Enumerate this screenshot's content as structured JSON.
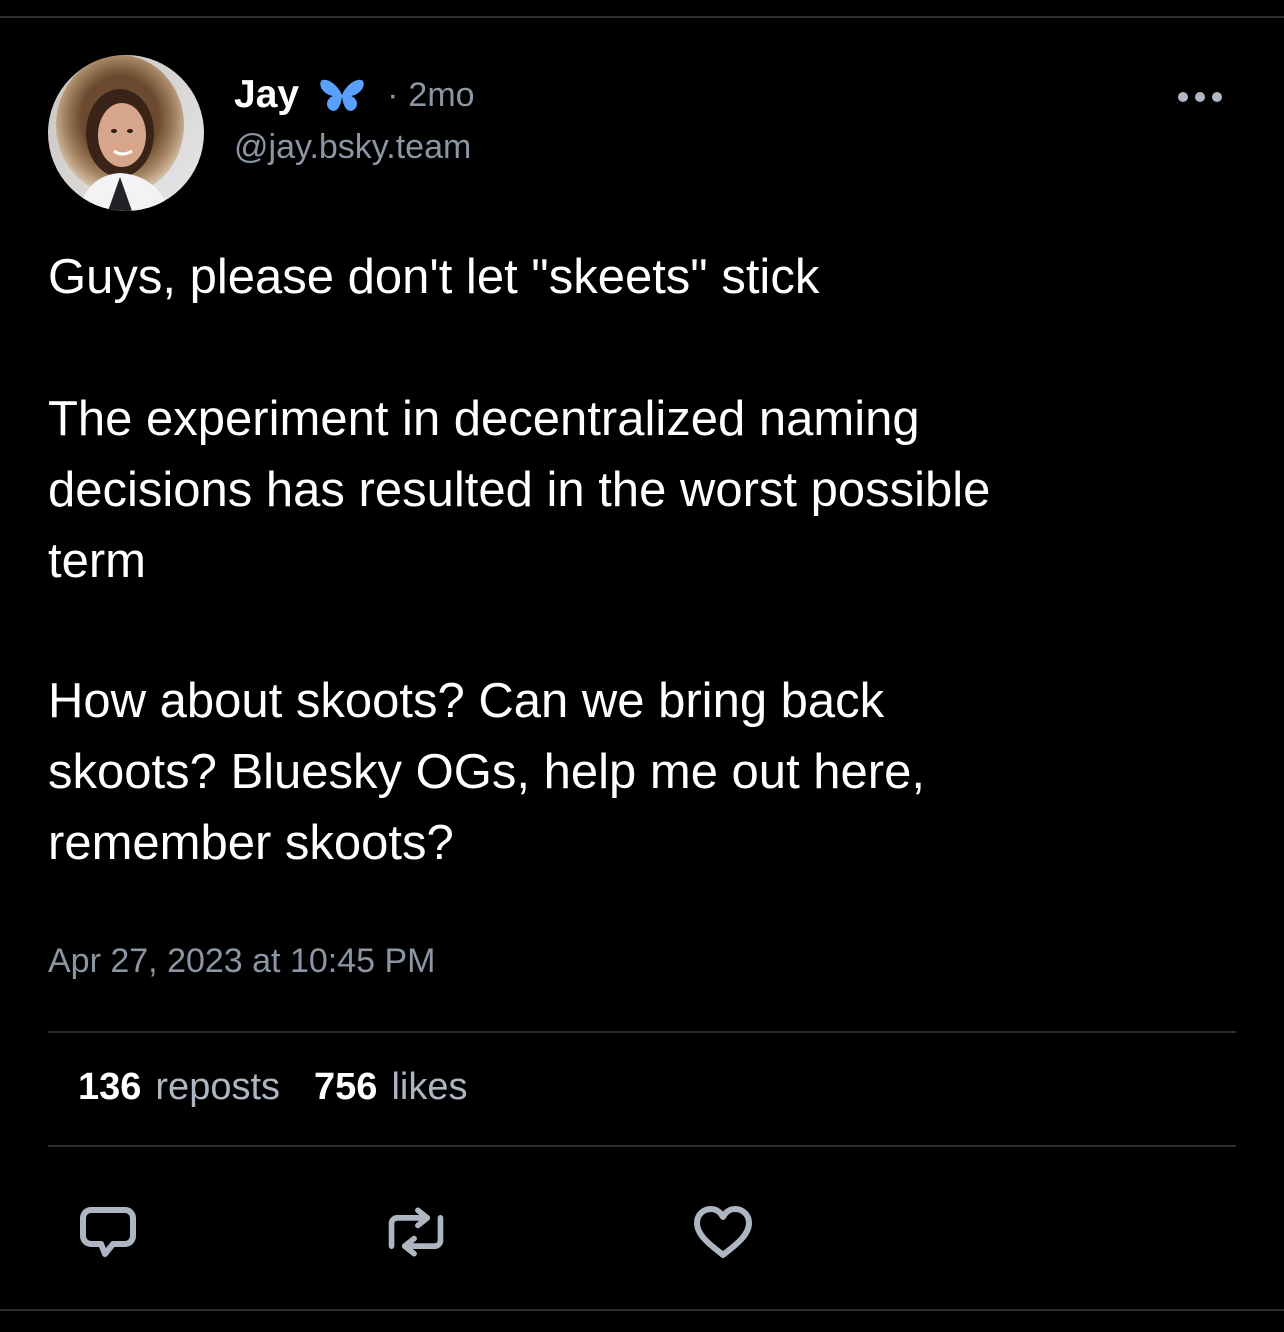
{
  "post": {
    "author": {
      "display_name": "Jay",
      "badge_icon": "butterfly-icon",
      "separator": "·",
      "age": "2mo",
      "handle": "@jay.bsky.team"
    },
    "text": {
      "paragraph1": "Guys, please don't let \"skeets\" stick",
      "paragraph2_line1": "The experiment in decentralized naming",
      "paragraph2_line2": "decisions has resulted in the worst possible",
      "paragraph2_line3": "term",
      "paragraph3_line1": "How about skoots? Can we bring back",
      "paragraph3_line2": "skoots? Bluesky OGs, help me out here,",
      "paragraph3_line3": "remember skoots?"
    },
    "timestamp": "Apr 27, 2023 at 10:45 PM",
    "stats": {
      "reposts_count": "136",
      "reposts_label": "reposts",
      "likes_count": "756",
      "likes_label": "likes"
    },
    "actions": [
      "reply-icon",
      "repost-icon",
      "like-icon"
    ]
  },
  "colors": {
    "background": "#000000",
    "text_primary": "#ffffff",
    "text_secondary": "#8b95a3",
    "divider": "#2a2d33",
    "butterfly": "#5aa0ff"
  }
}
